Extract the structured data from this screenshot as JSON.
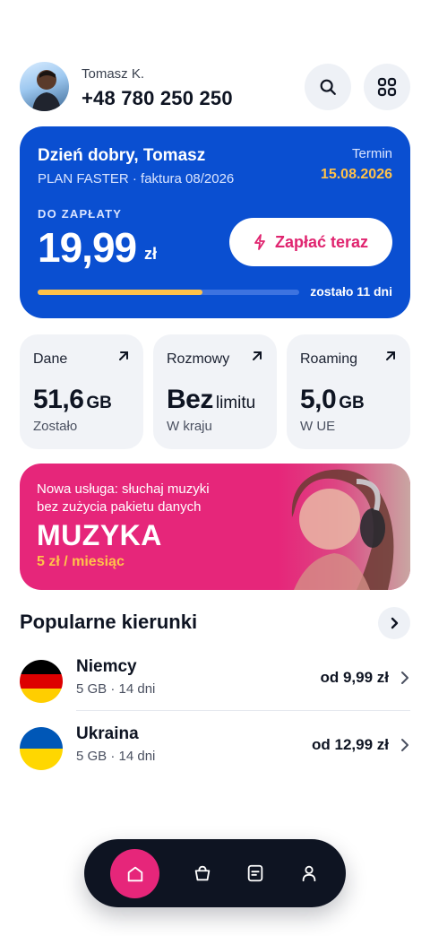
{
  "header": {
    "user_name": "Tomasz K.",
    "phone": "+48 780 250 250",
    "search_icon": "search-icon",
    "apps_icon": "grid-icon"
  },
  "billing": {
    "greeting": "Dzień dobry, Tomasz",
    "plan": "PLAN FASTER · faktura 08/2026",
    "term_label": "Termin",
    "term_date": "15.08.2026",
    "due_label": "DO ZAPŁATY",
    "amount": "19,99",
    "currency": "zł",
    "pay_label": "Zapłać teraz",
    "remaining": "zostało 11 dni",
    "progress_fraction": 0.63,
    "colors": {
      "card": "#0a4fd1",
      "accent": "#ffc24a",
      "pay": "#e0246f"
    }
  },
  "stats": [
    {
      "title": "Dane",
      "value": "51,6",
      "unit": "GB",
      "sub": "Zostało"
    },
    {
      "title": "Rozmowy",
      "value": "Bez",
      "unit": "limitu",
      "sub": "W kraju"
    },
    {
      "title": "Roaming",
      "value": "5,0",
      "unit": "GB",
      "sub": "W UE"
    }
  ],
  "promo": {
    "line1": "Nowa usługa: słuchaj muzyki",
    "line2": "bez zużycia pakietu danych",
    "title": "MUZYKA",
    "price": "5 zł / miesiąc",
    "color": "#e6267a"
  },
  "popular": {
    "title": "Popularne kierunki",
    "items": [
      {
        "name": "Niemcy",
        "meta": "5 GB · 14 dni",
        "price": "od 9,99 zł",
        "flag_colors": [
          "#000000",
          "#dd0000",
          "#ffce00"
        ]
      },
      {
        "name": "Ukraina",
        "meta": "5 GB · 14 dni",
        "price": "od 12,99 zł",
        "flag_colors": [
          "#0057b7",
          "#ffd700"
        ]
      }
    ]
  },
  "nav": {
    "items": [
      "home-icon",
      "basket-icon",
      "invoice-icon",
      "profile-icon"
    ]
  }
}
